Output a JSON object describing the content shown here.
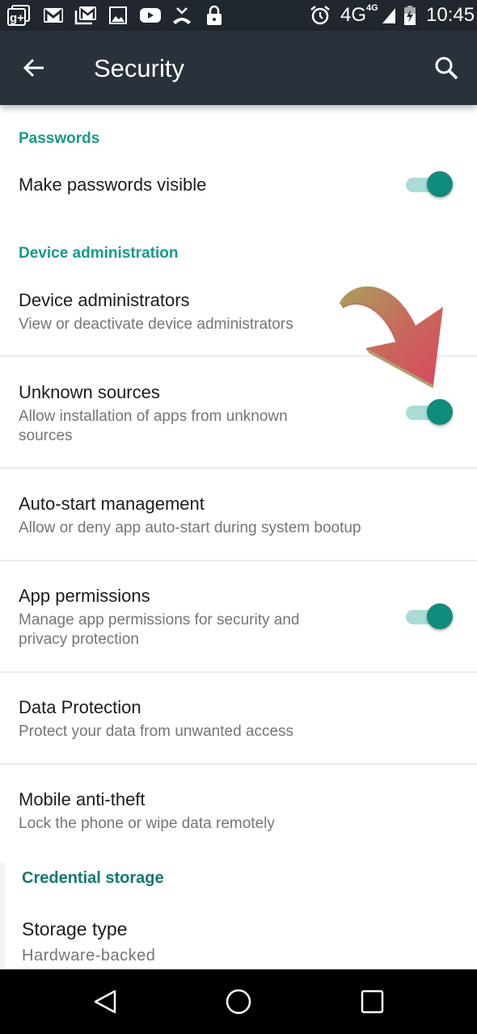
{
  "status_bar": {
    "left_icons": [
      "google-plus-icon",
      "gmail-icon",
      "gmail-stack-icon",
      "image-icon",
      "youtube-icon",
      "missed-call-icon",
      "lock-icon"
    ],
    "right_icons": [
      "alarm-icon",
      "signal-icon",
      "battery-charging-icon"
    ],
    "network": "4G",
    "network_secondary": "4G",
    "time": "10:45"
  },
  "toolbar": {
    "back_icon": "arrow-back-icon",
    "title": "Security",
    "search_icon": "search-icon"
  },
  "colors": {
    "accent": "#179a87",
    "toggle_thumb": "#0f8c7b",
    "toggle_track": "#a9dcd6",
    "toolbar_bg": "#29313a",
    "status_bar_bg": "#21272e"
  },
  "sections": [
    {
      "header": "Passwords",
      "items": [
        {
          "title": "Make passwords visible",
          "subtitle": "",
          "toggle": true,
          "checked": true
        }
      ]
    },
    {
      "header": "Device administration",
      "items": [
        {
          "title": "Device administrators",
          "subtitle": "View or deactivate device administrators",
          "toggle": false
        },
        {
          "title": "Unknown sources",
          "subtitle": "Allow installation of apps from unknown sources",
          "toggle": true,
          "checked": true
        },
        {
          "title": "Auto-start management",
          "subtitle": "Allow or deny app auto-start during system bootup",
          "toggle": false
        },
        {
          "title": "App permissions",
          "subtitle": "Manage app permissions for security and privacy protection",
          "toggle": true,
          "checked": true
        },
        {
          "title": "Data Protection",
          "subtitle": "Protect your data from unwanted access",
          "toggle": false
        },
        {
          "title": "Mobile anti-theft",
          "subtitle": "Lock the phone or wipe data remotely",
          "toggle": false
        }
      ]
    },
    {
      "header": "Credential storage",
      "items": [
        {
          "title": "Storage type",
          "subtitle": "Hardware-backed",
          "toggle": false
        }
      ]
    }
  ],
  "annotation": {
    "icon": "curved-arrow-icon",
    "points_to": "Unknown sources toggle"
  },
  "nav_bar": {
    "back": "nav-back-icon",
    "home": "nav-home-icon",
    "recents": "nav-recents-icon"
  }
}
